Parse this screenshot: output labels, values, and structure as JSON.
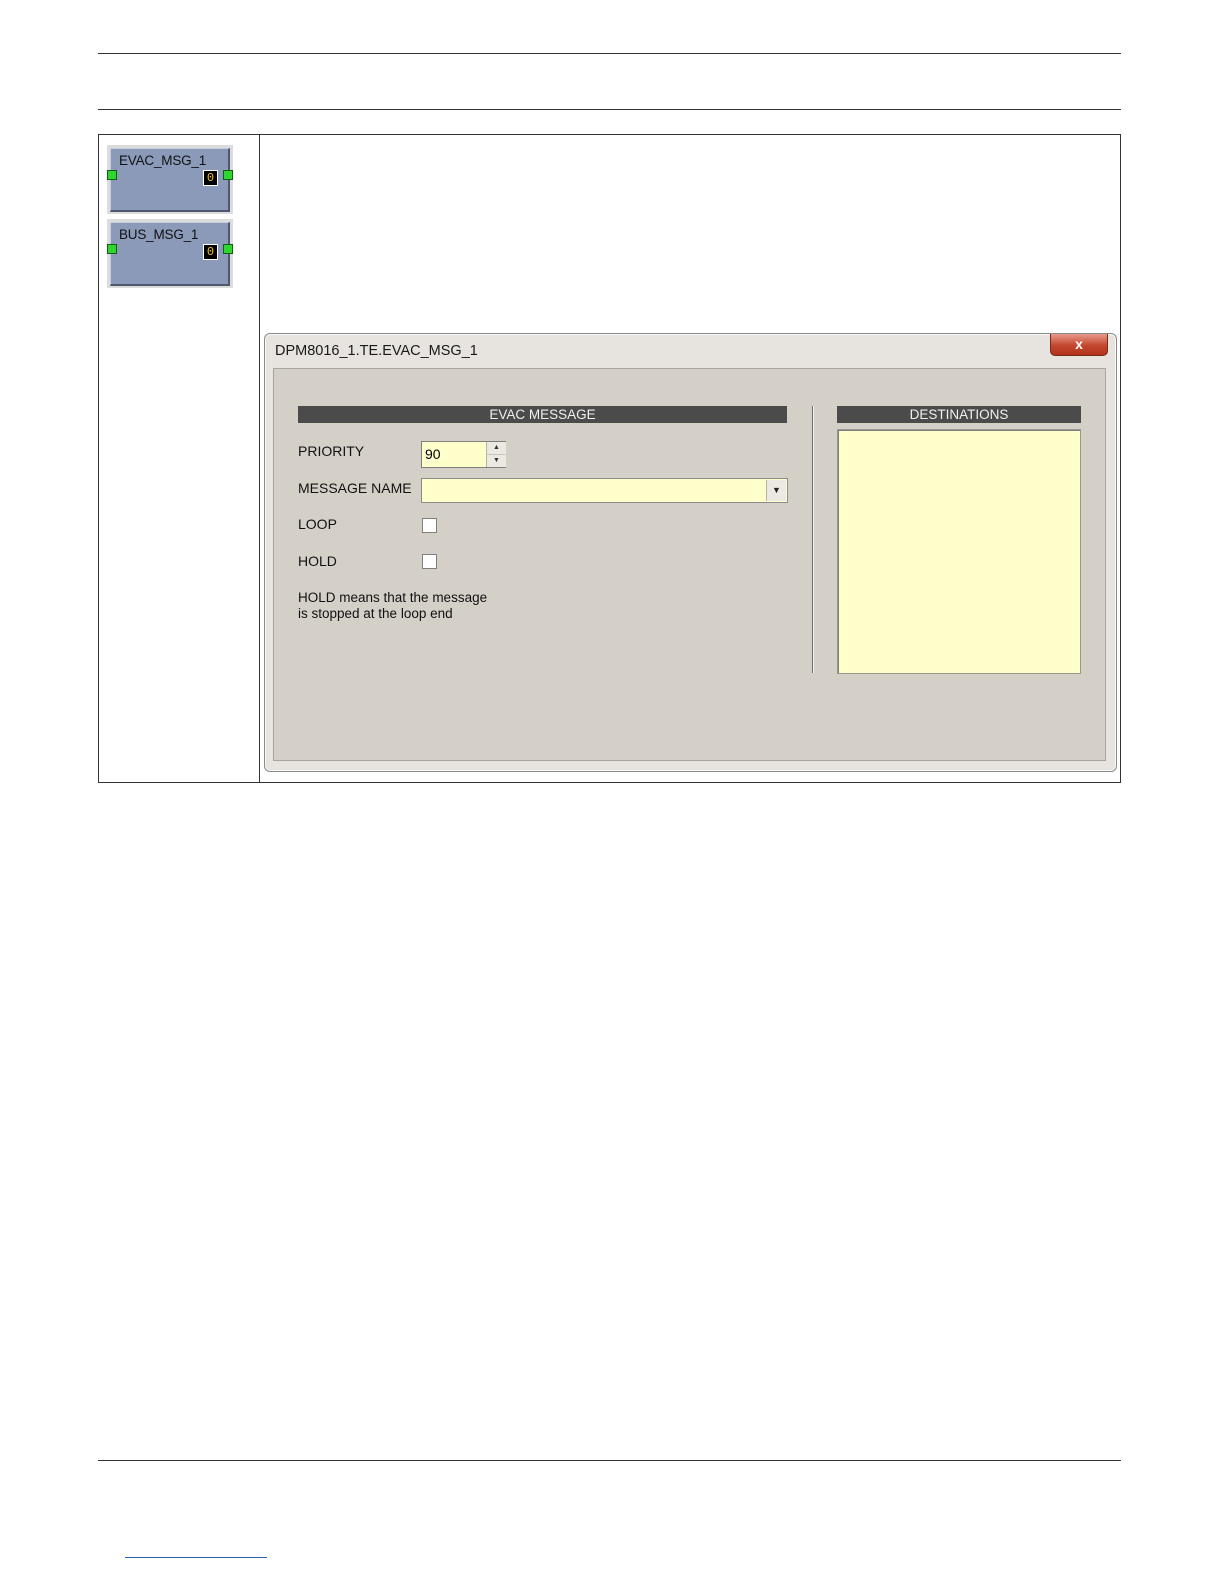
{
  "blocks": [
    {
      "title": "EVAC_MSG_1",
      "value": "0"
    },
    {
      "title": "BUS_MSG_1",
      "value": "0"
    }
  ],
  "dialog": {
    "title": "DPM8016_1.TE.EVAC_MSG_1",
    "close_label": "x",
    "evac_section": "EVAC MESSAGE",
    "destinations_section": "DESTINATIONS",
    "priority_label": "PRIORITY",
    "priority_value": "90",
    "message_name_label": "MESSAGE NAME",
    "message_name_value": "",
    "loop_label": "LOOP",
    "loop_checked": false,
    "hold_label": "HOLD",
    "hold_checked": false,
    "hold_note_line1": "HOLD means that the message",
    "hold_note_line2": "is stopped at the loop end",
    "destinations": []
  },
  "colors": {
    "block_fill": "#8a9ab8",
    "pin": "#2fd62f",
    "input_fill": "#ffffcc",
    "section_bar": "#4b4b4b",
    "dialog_bg": "#d4d0c8",
    "close_button": "#c4462f"
  }
}
